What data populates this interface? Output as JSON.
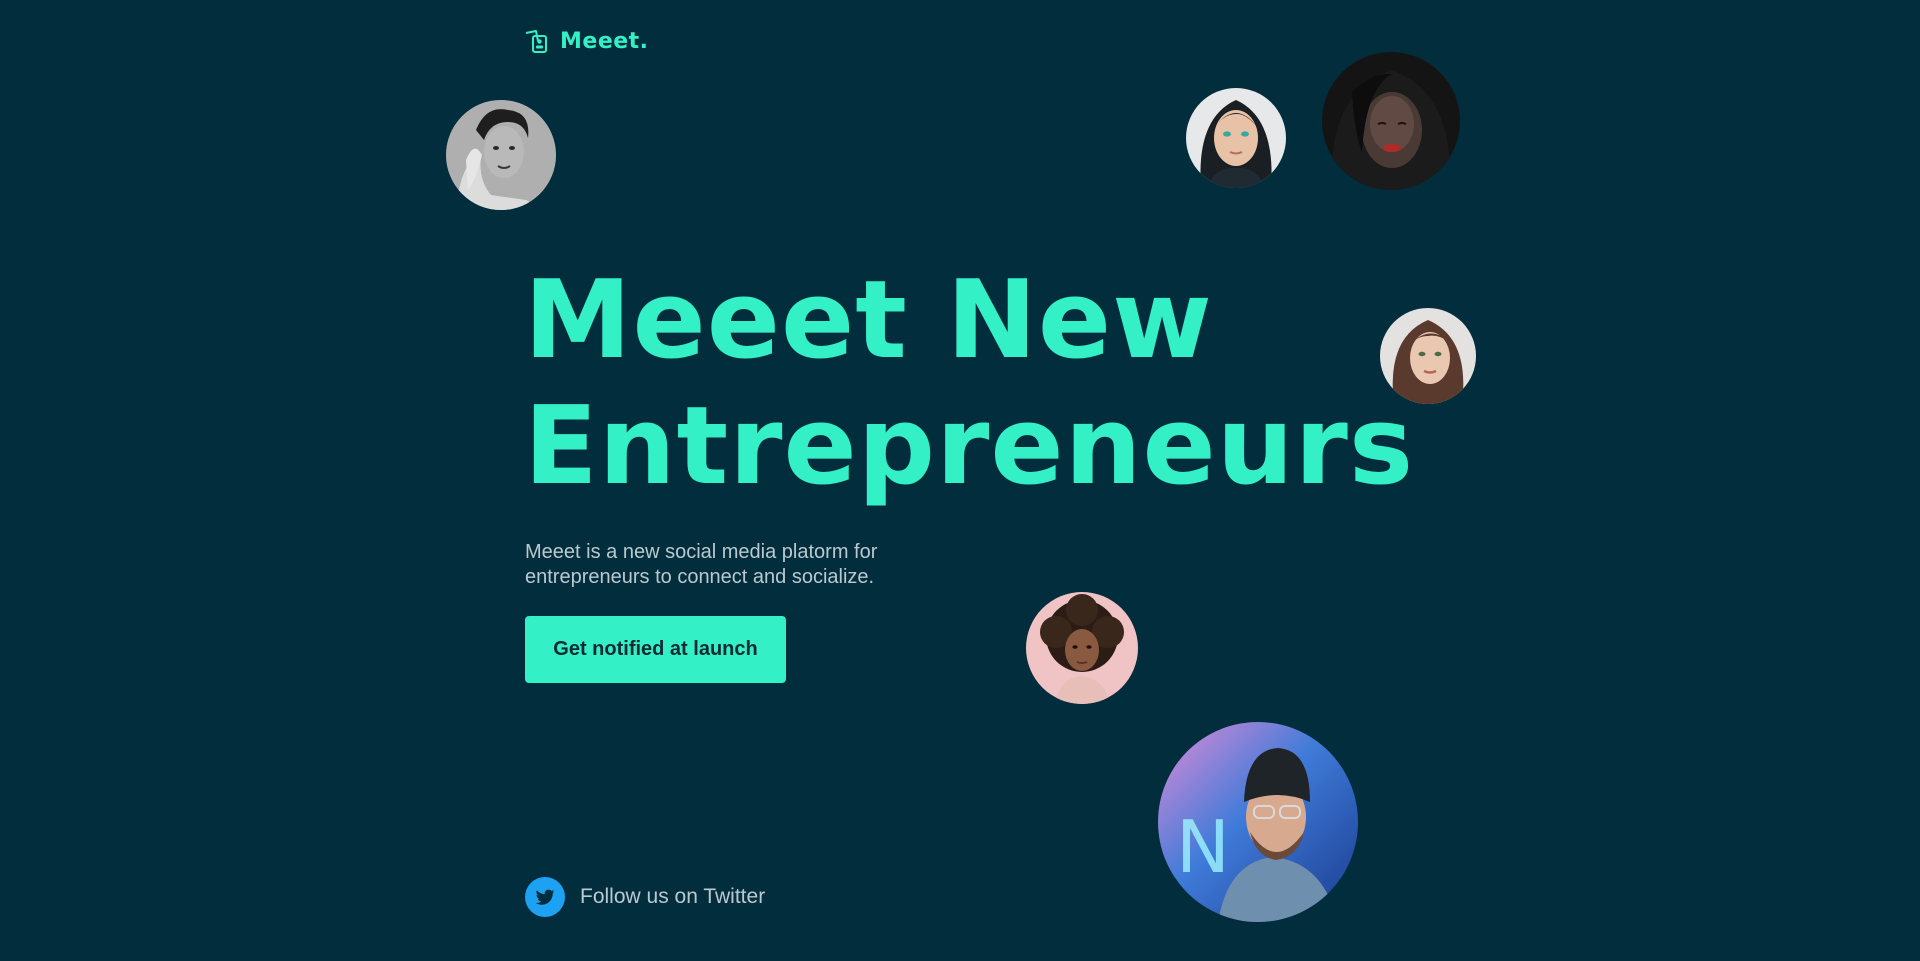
{
  "brand": {
    "name": "Meeet.",
    "icon": "meeet-logo-icon",
    "accent_color": "#33f0c6",
    "background_color": "#022d3d"
  },
  "hero": {
    "headline_line1": "Meeet New",
    "headline_line2": "Entrepreneurs",
    "description_line1": "Meeet is a new social media platorm for",
    "description_line2": "entrepreneurs to connect and socialize.",
    "cta_label": "Get notified at launch"
  },
  "social": {
    "twitter_label": "Follow us on Twitter",
    "icon": "twitter-icon",
    "icon_color": "#1da1f2"
  },
  "avatars": [
    {
      "name": "avatar-bw-man"
    },
    {
      "name": "avatar-woman-teal-eyes"
    },
    {
      "name": "avatar-woman-dark-portrait"
    },
    {
      "name": "avatar-woman-auburn-hair"
    },
    {
      "name": "avatar-woman-curly-hair"
    },
    {
      "name": "avatar-man-beanie-neon"
    }
  ]
}
